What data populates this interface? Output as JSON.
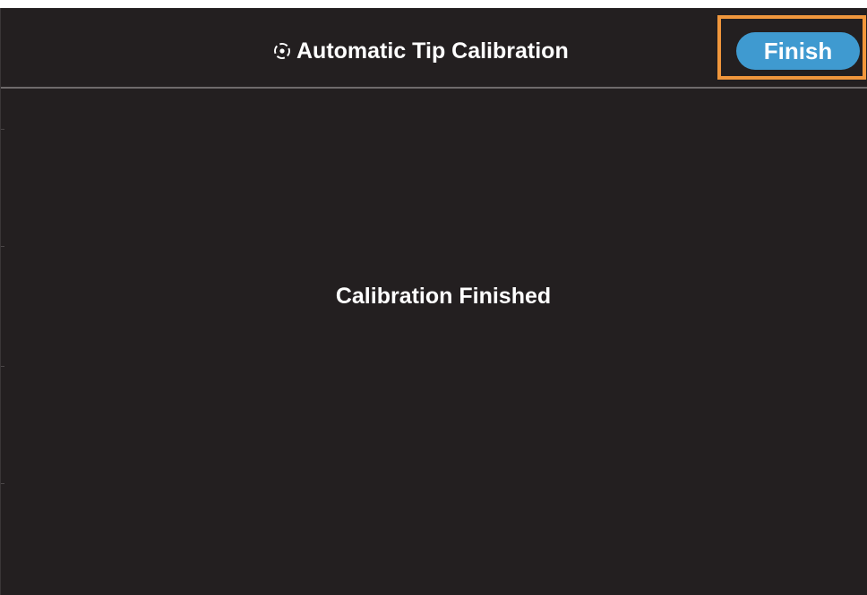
{
  "header": {
    "title": "Automatic Tip Calibration",
    "title_icon": "target-crosshair-icon",
    "finish_label": "Finish"
  },
  "main": {
    "status_text": "Calibration Finished"
  },
  "colors": {
    "background": "#231f20",
    "divider": "#6e6a6b",
    "finish_button": "#3f9ad0",
    "highlight_border": "#f0963c",
    "text": "#ffffff"
  }
}
